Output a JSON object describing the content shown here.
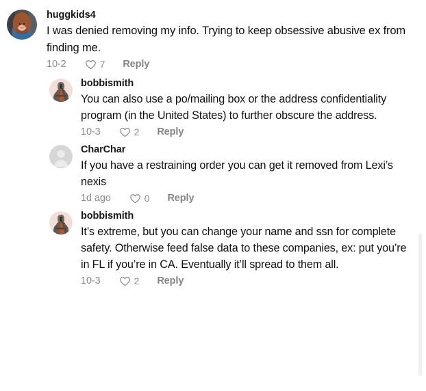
{
  "thread": {
    "comments": [
      {
        "username": "huggkids4",
        "text": "I was denied removing my info. Trying to keep obsessive abusive ex from finding me.",
        "date": "10-2",
        "like_count": "7",
        "reply_label": "Reply",
        "avatar_type": "photo-woman",
        "is_reply": false
      },
      {
        "username": "bobbismith",
        "text": "You can also use a po/mailing box or the address confidentiality program (in the United States) to further obscure the address.",
        "date": "10-3",
        "like_count": "2",
        "reply_label": "Reply",
        "avatar_type": "photo-knight",
        "is_reply": true
      },
      {
        "username": "CharChar",
        "text": "If you have a restraining order you can get it removed from Lexi’s nexis",
        "date": "1d ago",
        "like_count": "0",
        "reply_label": "Reply",
        "avatar_type": "default-person",
        "is_reply": true
      },
      {
        "username": "bobbismith",
        "text": "It’s extreme, but you can change your name and ssn for complete safety. Otherwise feed false data to these companies, ex: put you’re in FL if you’re in CA. Eventually it’ll spread to them all.",
        "date": "10-3",
        "like_count": "2",
        "reply_label": "Reply",
        "avatar_type": "photo-knight",
        "is_reply": true
      }
    ],
    "icons": {
      "like": "heart-outline-icon",
      "default_avatar": "person-avatar-icon"
    },
    "colors": {
      "background": "#ffffff",
      "text": "#101012",
      "muted": "#8a8b91",
      "scrollbar_thumb": "#f0f0f0"
    }
  }
}
